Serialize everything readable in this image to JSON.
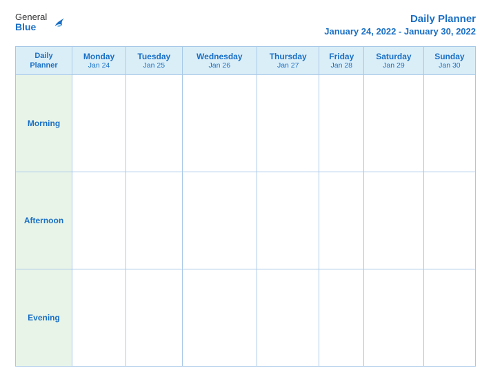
{
  "logo": {
    "general": "General",
    "blue": "Blue",
    "icon_label": "general-blue-logo"
  },
  "header": {
    "title": "Daily Planner",
    "date_range": "January 24, 2022 - January 30, 2022"
  },
  "table": {
    "label_header_line1": "Daily",
    "label_header_line2": "Planner",
    "columns": [
      {
        "day": "Monday",
        "date": "Jan 24"
      },
      {
        "day": "Tuesday",
        "date": "Jan 25"
      },
      {
        "day": "Wednesday",
        "date": "Jan 26"
      },
      {
        "day": "Thursday",
        "date": "Jan 27"
      },
      {
        "day": "Friday",
        "date": "Jan 28"
      },
      {
        "day": "Saturday",
        "date": "Jan 29"
      },
      {
        "day": "Sunday",
        "date": "Jan 30"
      }
    ],
    "rows": [
      {
        "label": "Morning"
      },
      {
        "label": "Afternoon"
      },
      {
        "label": "Evening"
      }
    ]
  }
}
